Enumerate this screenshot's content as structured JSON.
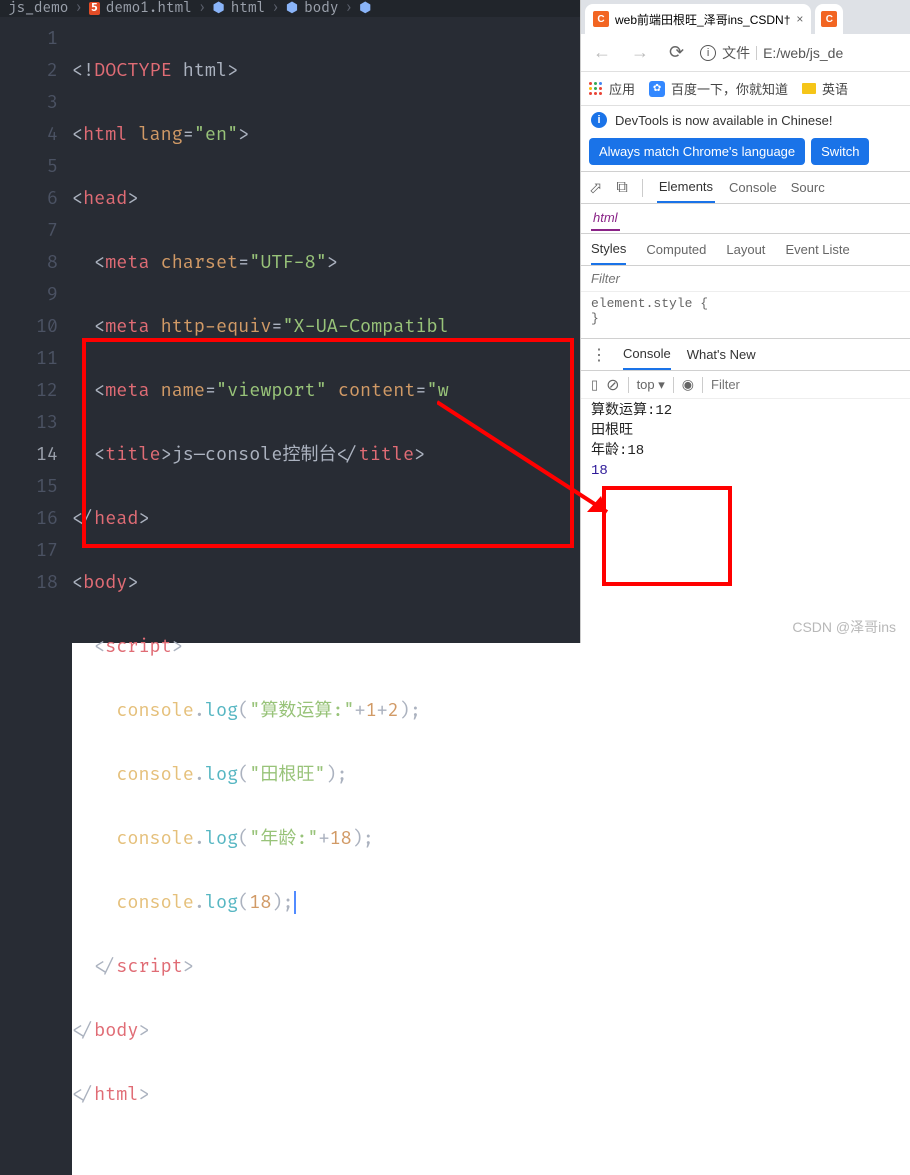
{
  "editor": {
    "crumbs": {
      "folder": "js_demo",
      "file": "demo1.html",
      "p1": "html",
      "p2": "body",
      "p3": ""
    },
    "lines": [
      "1",
      "2",
      "3",
      "4",
      "5",
      "6",
      "7",
      "8",
      "9",
      "10",
      "11",
      "12",
      "13",
      "14",
      "15",
      "16",
      "17",
      "18"
    ],
    "code": {
      "doctype_open": "<!",
      "doctype": "DOCTYPE",
      "doctype_h": " html",
      "doctype_close": ">",
      "html_open": "<",
      "html_tag": "html",
      "html_lang_attr": " lang",
      "eq": "=",
      "html_lang_val": "\"en\"",
      "tag_close": ">",
      "head": "head",
      "meta": "meta",
      "charset_attr": " charset",
      "charset_val": "\"UTF-8\"",
      "httpeq_attr": " http-equiv",
      "httpeq_val": "\"X-UA-Compatibl",
      "name_attr": " name",
      "name_val": "\"viewport\"",
      "content_attr": " content",
      "content_val": "\"w",
      "title": "title",
      "title_text": "js—console控制台",
      "body": "body",
      "script": "script",
      "console": "console",
      "dot": ".",
      "log": "log",
      "lp": "(",
      "rp": ")",
      "s1": "\"算数运算:\"",
      "plus": "+",
      "n1": "1",
      "n2": "2",
      "semi": ";",
      "s2": "\"田根旺\"",
      "s3": "\"年龄:\"",
      "n18": "18"
    }
  },
  "browser": {
    "tab": {
      "title": "web前端田根旺_泽哥ins_CSDN†",
      "close": "×"
    },
    "addr": {
      "file_label": "文件",
      "path": "E:/web/js_de"
    },
    "bookmarks": {
      "apps": "应用",
      "baidu": "百度一下，你就知道",
      "eng": "英语"
    },
    "infobar": "DevTools is now available in Chinese!",
    "btn1": "Always match Chrome's language",
    "btn2": "Switch",
    "dt": {
      "tabs": {
        "elements": "Elements",
        "console": "Console",
        "sources": "Sourc"
      },
      "html": "html",
      "styles": {
        "styles": "Styles",
        "computed": "Computed",
        "layout": "Layout",
        "event": "Event Liste"
      },
      "filter_ph": "Filter",
      "css": "element.style {",
      "css_close": "}",
      "drawer": {
        "console": "Console",
        "whatsnew": "What's New"
      },
      "cbar": {
        "top": "top",
        "filter_ph": "Filter"
      },
      "out": [
        "算数运算:12",
        "田根旺",
        "年龄:18",
        "18"
      ]
    }
  },
  "watermark": "CSDN @泽哥ins"
}
